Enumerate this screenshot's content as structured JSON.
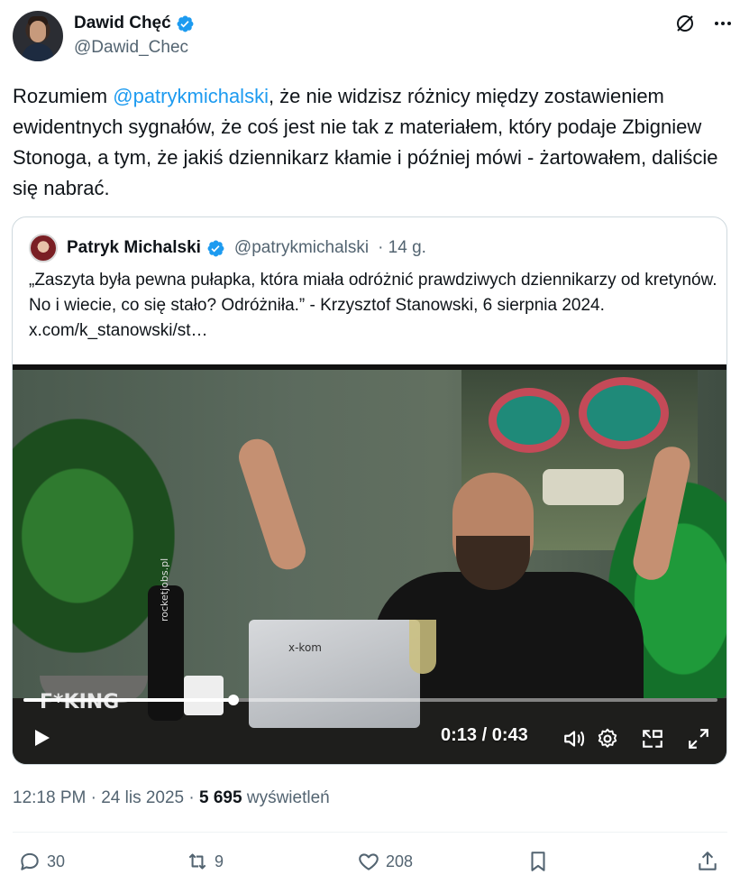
{
  "author": {
    "display_name": "Dawid Chęć",
    "handle": "@Dawid_Chec",
    "verified": true
  },
  "tweet": {
    "text_prefix": "Rozumiem ",
    "mention": "@patrykmichalski",
    "text_suffix": ", że nie widzisz różnicy między zostawieniem ewidentnych sygnałów, że coś jest nie tak z materiałem, który podaje Zbigniew Stonoga, a tym, że jakiś dziennikarz kłamie i później mówi - żartowałem, daliście się nabrać."
  },
  "quote": {
    "display_name": "Patryk Michalski",
    "handle": "@patrykmichalski",
    "age": "· 14 g.",
    "text": "„Zaszyta była pewna pułapka, która miała odróżnić prawdziwych dziennikarzy od kretynów. No i wiecie, co się stało? Odróżniła.” - Krzysztof Stanowski, 6 sierpnia 2024.  x.com/k_stanowski/st…"
  },
  "video": {
    "time_display": "0:13 / 0:43",
    "progress_fraction": 0.302,
    "overlay_texts": {
      "laptop_brand": "x-kom",
      "bottle": "rocketjobs.pl",
      "caption": "F*KING"
    }
  },
  "meta": {
    "time": "12:18 PM",
    "sep1": " · ",
    "date": "24 lis 2025",
    "sep2": " · ",
    "views_count": "5 695",
    "views_label": " wyświetleń"
  },
  "actions": {
    "replies": "30",
    "reposts": "9",
    "likes": "208"
  },
  "colors": {
    "accent": "#1d9bf0",
    "text": "#0f1419",
    "secondary": "#536471"
  }
}
